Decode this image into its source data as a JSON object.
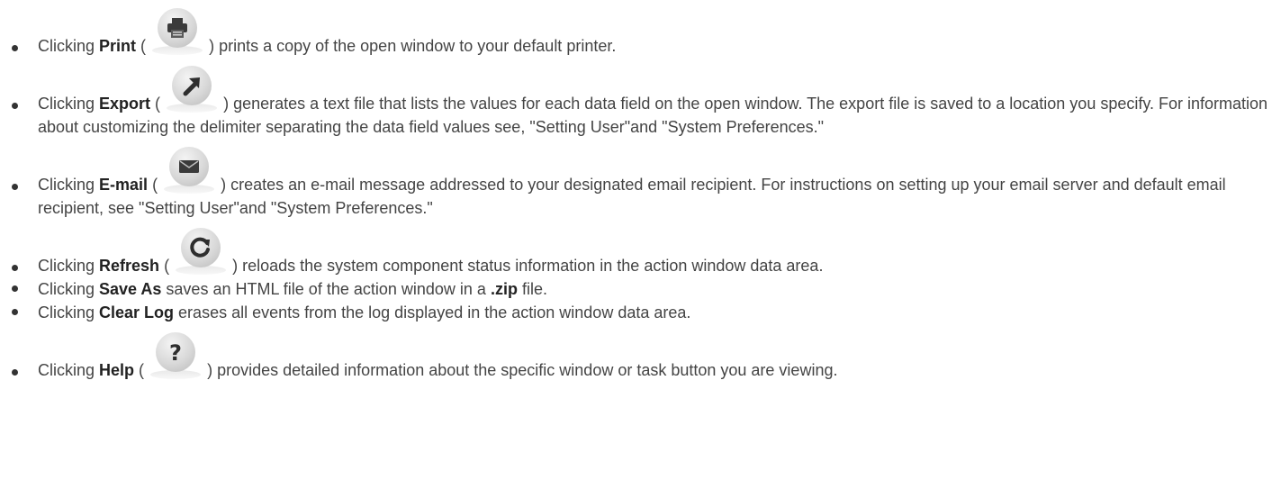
{
  "items": [
    {
      "pre": "Clicking ",
      "bold": "Print",
      "open": " (",
      "icon": "printer-icon",
      "close": ") ",
      "rest": "prints a copy of the open window to your default printer."
    },
    {
      "pre": "Clicking ",
      "bold": "Export",
      "open": " (",
      "icon": "export-arrow-icon",
      "close": ") ",
      "rest": "generates a text file that lists the values for each data field on the open window. The export file is saved to a location you specify. For information about customizing the delimiter separating the data field values see, \"Setting User\"and \"System Preferences.\""
    },
    {
      "pre": "Clicking ",
      "bold": "E-mail",
      "open": " (",
      "icon": "envelope-icon",
      "close": ") ",
      "rest": "creates an e-mail message addressed to your designated email recipient. For instructions on setting up your email server and default email recipient, see \"Setting User\"and \"System Preferences.\""
    },
    {
      "pre": "Clicking ",
      "bold": "Refresh",
      "open": " (",
      "icon": "refresh-icon",
      "close": ") ",
      "rest": "reloads the system component status information in the action window data area."
    },
    {
      "pre": "Clicking ",
      "bold": "Save As",
      "rest": " saves an HTML file of the action window in a ",
      "bold2": ".zip",
      "rest2": " file."
    },
    {
      "pre": "Clicking ",
      "bold": "Clear Log",
      "rest": " erases all events from the log displayed in the action window data area."
    },
    {
      "pre": "Clicking ",
      "bold": "Help",
      "open": " (",
      "icon": "help-icon",
      "close": ") ",
      "rest": "provides detailed information about the specific window or task button you are viewing."
    }
  ],
  "colors": {
    "text": "#444444",
    "bold": "#222222",
    "icon_glyph": "#3a3a3a"
  }
}
